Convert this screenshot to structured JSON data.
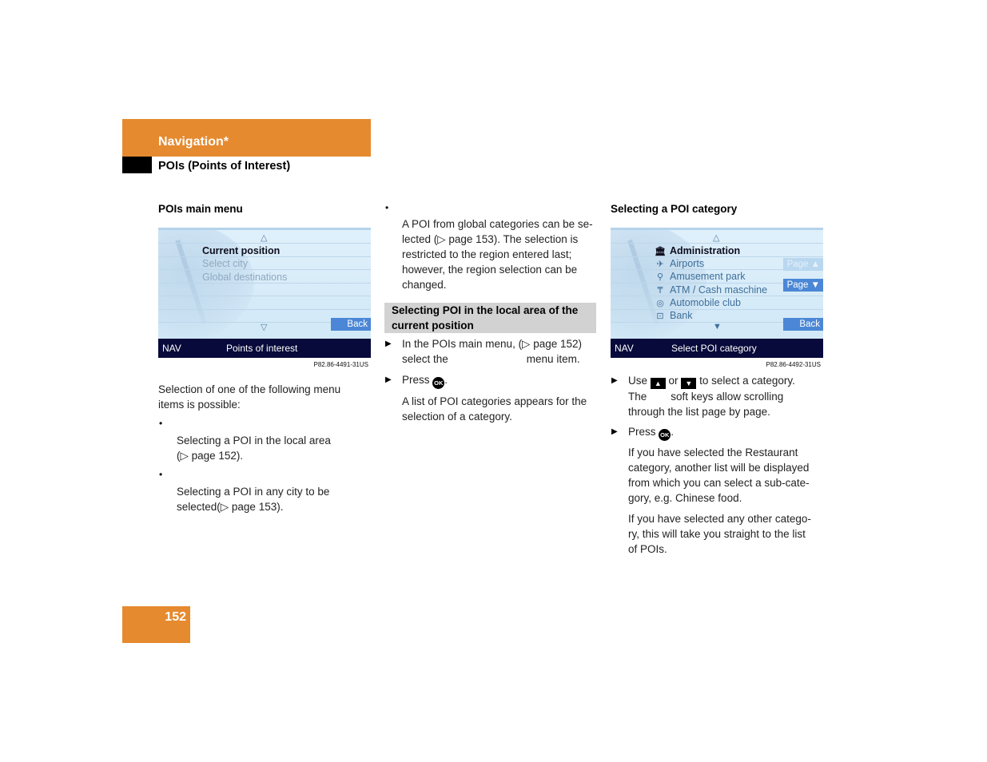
{
  "header": {
    "chapter": "Navigation*",
    "section": "POIs (Points of Interest)"
  },
  "col1": {
    "heading": "POIs main menu",
    "screen": {
      "items": [
        {
          "label": "Current position",
          "state": "selected"
        },
        {
          "label": "Select city",
          "state": "dimmed"
        },
        {
          "label": "Global destinations",
          "state": "dimmed"
        }
      ],
      "up_arrow": "△",
      "down_arrow": "▽",
      "softkey_back": "Back",
      "status_left": "NAV",
      "status_title": "Points of interest"
    },
    "caption": "P82.86-4491-31US",
    "intro": "Selection of one of the following menu items is possible:",
    "bullets": [
      {
        "marker": "•",
        "lines": [
          "Selecting a POI in the local area",
          "(▷ page 152)."
        ]
      },
      {
        "marker": "•",
        "lines": [
          "Selecting a POI in any city to be",
          "selected(▷ page 153)."
        ]
      }
    ]
  },
  "col2": {
    "bullet": {
      "marker": "•",
      "lines": [
        "A POI from global categories can be se-",
        "lected (▷ page 153). The selection is",
        "restricted to the region entered last;",
        "however, the region selection can be",
        "changed."
      ]
    },
    "box_heading": [
      "Selecting POI in the local area of the",
      "current position"
    ],
    "steps": [
      {
        "marker": "▶",
        "lines": [
          "In the POIs main menu, (▷ page 152)",
          "select the",
          "menu item."
        ]
      },
      {
        "marker": "▶",
        "prefix": "Press",
        "key": "OK",
        "suffix": "."
      }
    ],
    "result": [
      "A list of POI categories appears for the",
      "selection of a category."
    ]
  },
  "col3": {
    "heading": "Selecting a POI category",
    "screen": {
      "items": [
        {
          "icon": "administration-icon",
          "glyph": "🏛",
          "label": "Administration",
          "state": "selected"
        },
        {
          "icon": "airport-icon",
          "glyph": "✈",
          "label": "Airports",
          "state": "normal"
        },
        {
          "icon": "amusement-park-icon",
          "glyph": "⚲",
          "label": "Amusement park",
          "state": "normal"
        },
        {
          "icon": "atm-icon",
          "glyph": "₸",
          "label": "ATM / Cash maschine",
          "state": "normal"
        },
        {
          "icon": "automobile-club-icon",
          "glyph": "◎",
          "label": "Automobile club",
          "state": "normal"
        },
        {
          "icon": "bank-icon",
          "glyph": "⊡",
          "label": "Bank",
          "state": "normal"
        }
      ],
      "up_arrow": "△",
      "down_arrow": "▼",
      "softkey_page_up": "Page ▲",
      "softkey_page_down": "Page ▼",
      "softkey_back": "Back",
      "status_left": "NAV",
      "status_title": "Select POI category"
    },
    "caption": "P82.86-4492-31US",
    "steps": [
      {
        "marker": "▶",
        "use": "Use",
        "key_up": "▲",
        "or": "or",
        "key_down": "▼",
        "rest": "to select a category.",
        "line2a": "The",
        "line2b": "soft keys allow scrolling",
        "line3": "through the list page by page."
      },
      {
        "marker": "▶",
        "prefix": "Press",
        "key": "OK",
        "suffix": "."
      }
    ],
    "para1": [
      "If you have selected the Restaurant",
      "category, another list will be displayed",
      "from which you can select a sub-cate-",
      "gory, e.g. Chinese food."
    ],
    "para2": [
      "If you have selected any other catego-",
      "ry, this will take you straight to the list",
      "of POIs."
    ]
  },
  "footer": {
    "page_number": "152"
  }
}
